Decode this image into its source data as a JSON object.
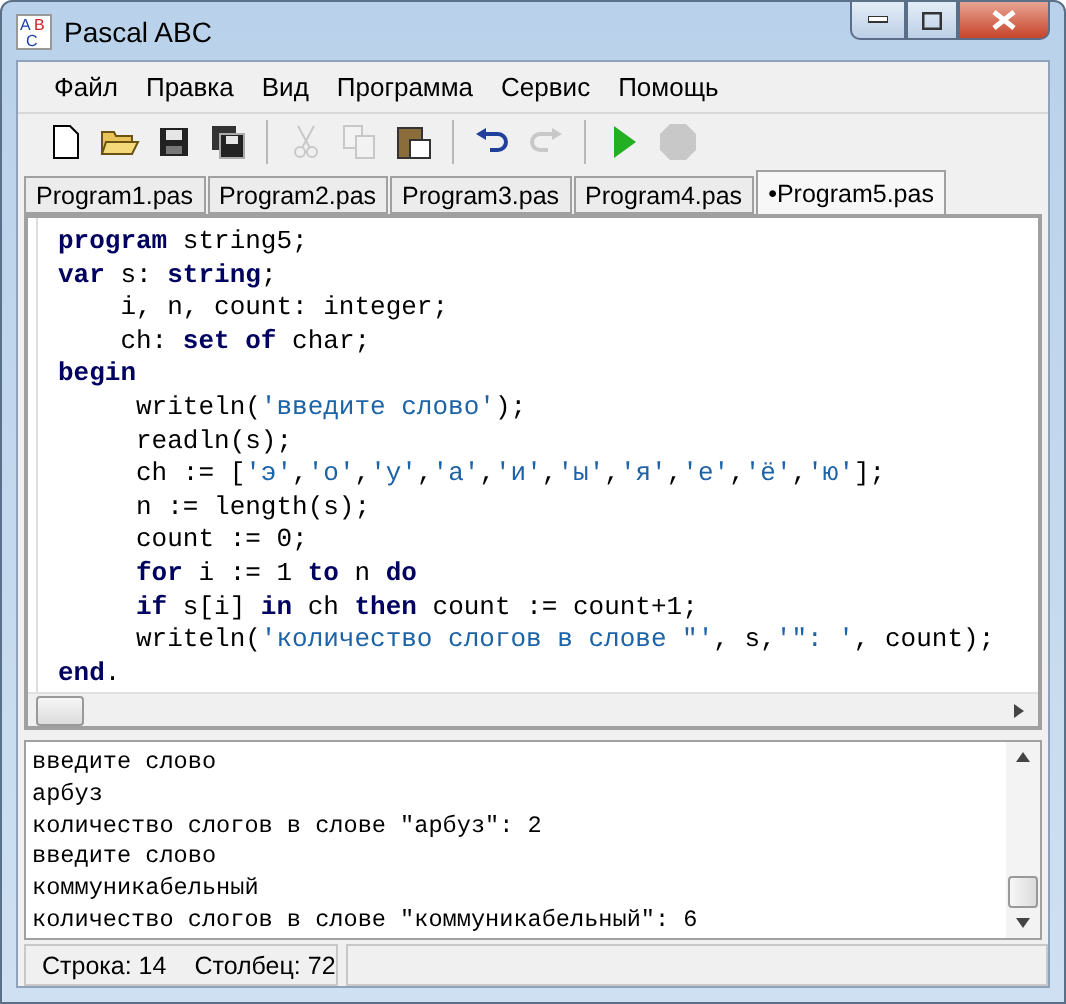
{
  "window": {
    "title": "Pascal ABC",
    "logo_letters": [
      "A",
      "B",
      "C"
    ]
  },
  "menu": [
    "Файл",
    "Правка",
    "Вид",
    "Программа",
    "Сервис",
    "Помощь"
  ],
  "toolbar": [
    {
      "kind": "new",
      "disabled": false
    },
    {
      "kind": "open",
      "disabled": false
    },
    {
      "kind": "save",
      "disabled": false
    },
    {
      "kind": "saveall",
      "disabled": false
    },
    {
      "kind": "sep"
    },
    {
      "kind": "cut",
      "disabled": true
    },
    {
      "kind": "copy",
      "disabled": true
    },
    {
      "kind": "paste",
      "disabled": false
    },
    {
      "kind": "sep"
    },
    {
      "kind": "undo",
      "disabled": false
    },
    {
      "kind": "redo",
      "disabled": true
    },
    {
      "kind": "sep"
    },
    {
      "kind": "run",
      "disabled": false
    },
    {
      "kind": "stop",
      "disabled": true
    }
  ],
  "tabs": [
    {
      "label": "Program1.pas",
      "selected": false
    },
    {
      "label": "Program2.pas",
      "selected": false
    },
    {
      "label": "Program3.pas",
      "selected": false
    },
    {
      "label": "Program4.pas",
      "selected": false
    },
    {
      "label": "•Program5.pas",
      "selected": true
    }
  ],
  "code": [
    [
      {
        "kind": "keyword",
        "text": "program"
      },
      {
        "kind": "plain",
        "text": " string5;"
      }
    ],
    [
      {
        "kind": "keyword",
        "text": "var"
      },
      {
        "kind": "plain",
        "text": " s: "
      },
      {
        "kind": "keyword",
        "text": "string"
      },
      {
        "kind": "plain",
        "text": ";"
      }
    ],
    [
      {
        "kind": "plain",
        "text": "    i, n, count: integer;"
      }
    ],
    [
      {
        "kind": "plain",
        "text": "    ch: "
      },
      {
        "kind": "keyword",
        "text": "set of"
      },
      {
        "kind": "plain",
        "text": " char;"
      }
    ],
    [
      {
        "kind": "keyword",
        "text": "begin"
      }
    ],
    [
      {
        "kind": "plain",
        "text": "     writeln("
      },
      {
        "kind": "string",
        "text": "'введите слово'"
      },
      {
        "kind": "plain",
        "text": ");"
      }
    ],
    [
      {
        "kind": "plain",
        "text": "     readln(s);"
      }
    ],
    [
      {
        "kind": "plain",
        "text": "     ch := ["
      },
      {
        "kind": "string",
        "text": "'э'"
      },
      {
        "kind": "plain",
        "text": ","
      },
      {
        "kind": "string",
        "text": "'о'"
      },
      {
        "kind": "plain",
        "text": ","
      },
      {
        "kind": "string",
        "text": "'у'"
      },
      {
        "kind": "plain",
        "text": ","
      },
      {
        "kind": "string",
        "text": "'а'"
      },
      {
        "kind": "plain",
        "text": ","
      },
      {
        "kind": "string",
        "text": "'и'"
      },
      {
        "kind": "plain",
        "text": ","
      },
      {
        "kind": "string",
        "text": "'ы'"
      },
      {
        "kind": "plain",
        "text": ","
      },
      {
        "kind": "string",
        "text": "'я'"
      },
      {
        "kind": "plain",
        "text": ","
      },
      {
        "kind": "string",
        "text": "'е'"
      },
      {
        "kind": "plain",
        "text": ","
      },
      {
        "kind": "string",
        "text": "'ё'"
      },
      {
        "kind": "plain",
        "text": ","
      },
      {
        "kind": "string",
        "text": "'ю'"
      },
      {
        "kind": "plain",
        "text": "];"
      }
    ],
    [
      {
        "kind": "plain",
        "text": "     n := length(s);"
      }
    ],
    [
      {
        "kind": "plain",
        "text": "     count := 0;"
      }
    ],
    [
      {
        "kind": "keyword",
        "text": "     for"
      },
      {
        "kind": "plain",
        "text": " i := 1 "
      },
      {
        "kind": "keyword",
        "text": "to"
      },
      {
        "kind": "plain",
        "text": " n "
      },
      {
        "kind": "keyword",
        "text": "do"
      }
    ],
    [
      {
        "kind": "keyword",
        "text": "     if"
      },
      {
        "kind": "plain",
        "text": " s[i] "
      },
      {
        "kind": "keyword",
        "text": "in"
      },
      {
        "kind": "plain",
        "text": " ch "
      },
      {
        "kind": "keyword",
        "text": "then"
      },
      {
        "kind": "plain",
        "text": " count := count+1;"
      }
    ],
    [
      {
        "kind": "plain",
        "text": "     writeln("
      },
      {
        "kind": "string",
        "text": "'количество слогов в слове \"'"
      },
      {
        "kind": "plain",
        "text": ", s,"
      },
      {
        "kind": "string",
        "text": "'\": '"
      },
      {
        "kind": "plain",
        "text": ", count);"
      }
    ],
    [
      {
        "kind": "keyword",
        "text": "end"
      },
      {
        "kind": "plain",
        "text": "."
      }
    ]
  ],
  "output": [
    "введите слово",
    "арбуз",
    "количество слогов в слове \"арбуз\": 2",
    "введите слово",
    "коммуникабельный",
    "количество слогов в слове \"коммуникабельный\": 6"
  ],
  "status_bar": {
    "line": "Строка: 14",
    "column": "Столбец: 72"
  }
}
